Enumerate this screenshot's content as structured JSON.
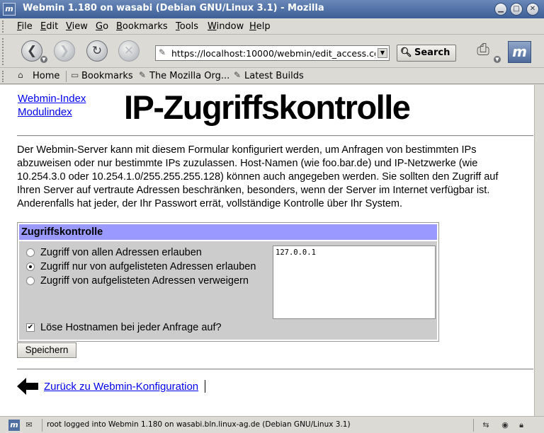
{
  "window": {
    "title": "Webmin 1.180 on wasabi (Debian GNU/Linux 3.1) - Mozilla"
  },
  "menubar": {
    "items": [
      "File",
      "Edit",
      "View",
      "Go",
      "Bookmarks",
      "Tools",
      "Window",
      "Help"
    ]
  },
  "navbar": {
    "url": "https://localhost:10000/webmin/edit_access.cgi",
    "search_label": "Search"
  },
  "personal_toolbar": {
    "home": "Home",
    "bookmarks": "Bookmarks",
    "mozilla_org": "The Mozilla Org...",
    "latest_builds": "Latest Builds"
  },
  "page": {
    "links": {
      "webmin_index": "Webmin-Index",
      "module_index": "Modulindex"
    },
    "title": "IP-Zugriffskontrolle",
    "intro_lines": [
      "Der Webmin-Server kann mit diesem Formular konfiguriert werden, um Anfragen von bestimmten IPs",
      "abzuweisen oder nur bestimmte IPs zuzulassen. Host-Namen (wie foo.bar.de) und IP-Netzwerke (wie",
      "10.254.3.0 oder 10.254.1.0/255.255.255.128) können auch angegeben werden. Sie sollten den Zugriff auf",
      "Ihren Server auf vertraute Adressen beschränken, besonders, wenn der Server im Internet verfügbar ist.",
      "Anderenfalls hat jeder, der Ihr Passwort errät, vollständige Kontrolle über Ihr System."
    ],
    "access_box": {
      "header": "Zugriffskontrolle",
      "options": [
        {
          "label": "Zugriff von allen Adressen erlauben",
          "selected": false
        },
        {
          "label": "Zugriff nur von aufgelisteten Adressen erlauben",
          "selected": true
        },
        {
          "label": "Zugriff von aufgelisteten Adressen verweigern",
          "selected": false
        }
      ],
      "ip_list": "127.0.0.1",
      "resolve_label": "Löse Hostnamen bei jeder Anfrage auf?",
      "resolve_checked": true
    },
    "save_label": "Speichern",
    "back_link": "Zurück zu Webmin-Konfiguration"
  },
  "statusbar": {
    "text": "root logged into Webmin 1.180 on wasabi.bln.linux-ag.de (Debian GNU/Linux 3.1)"
  },
  "colors": {
    "titlebar": "#3c5f97",
    "table_header": "#9999ff",
    "table_body": "#cccccc",
    "link": "#0000ee",
    "chrome": "#dcdad5"
  }
}
